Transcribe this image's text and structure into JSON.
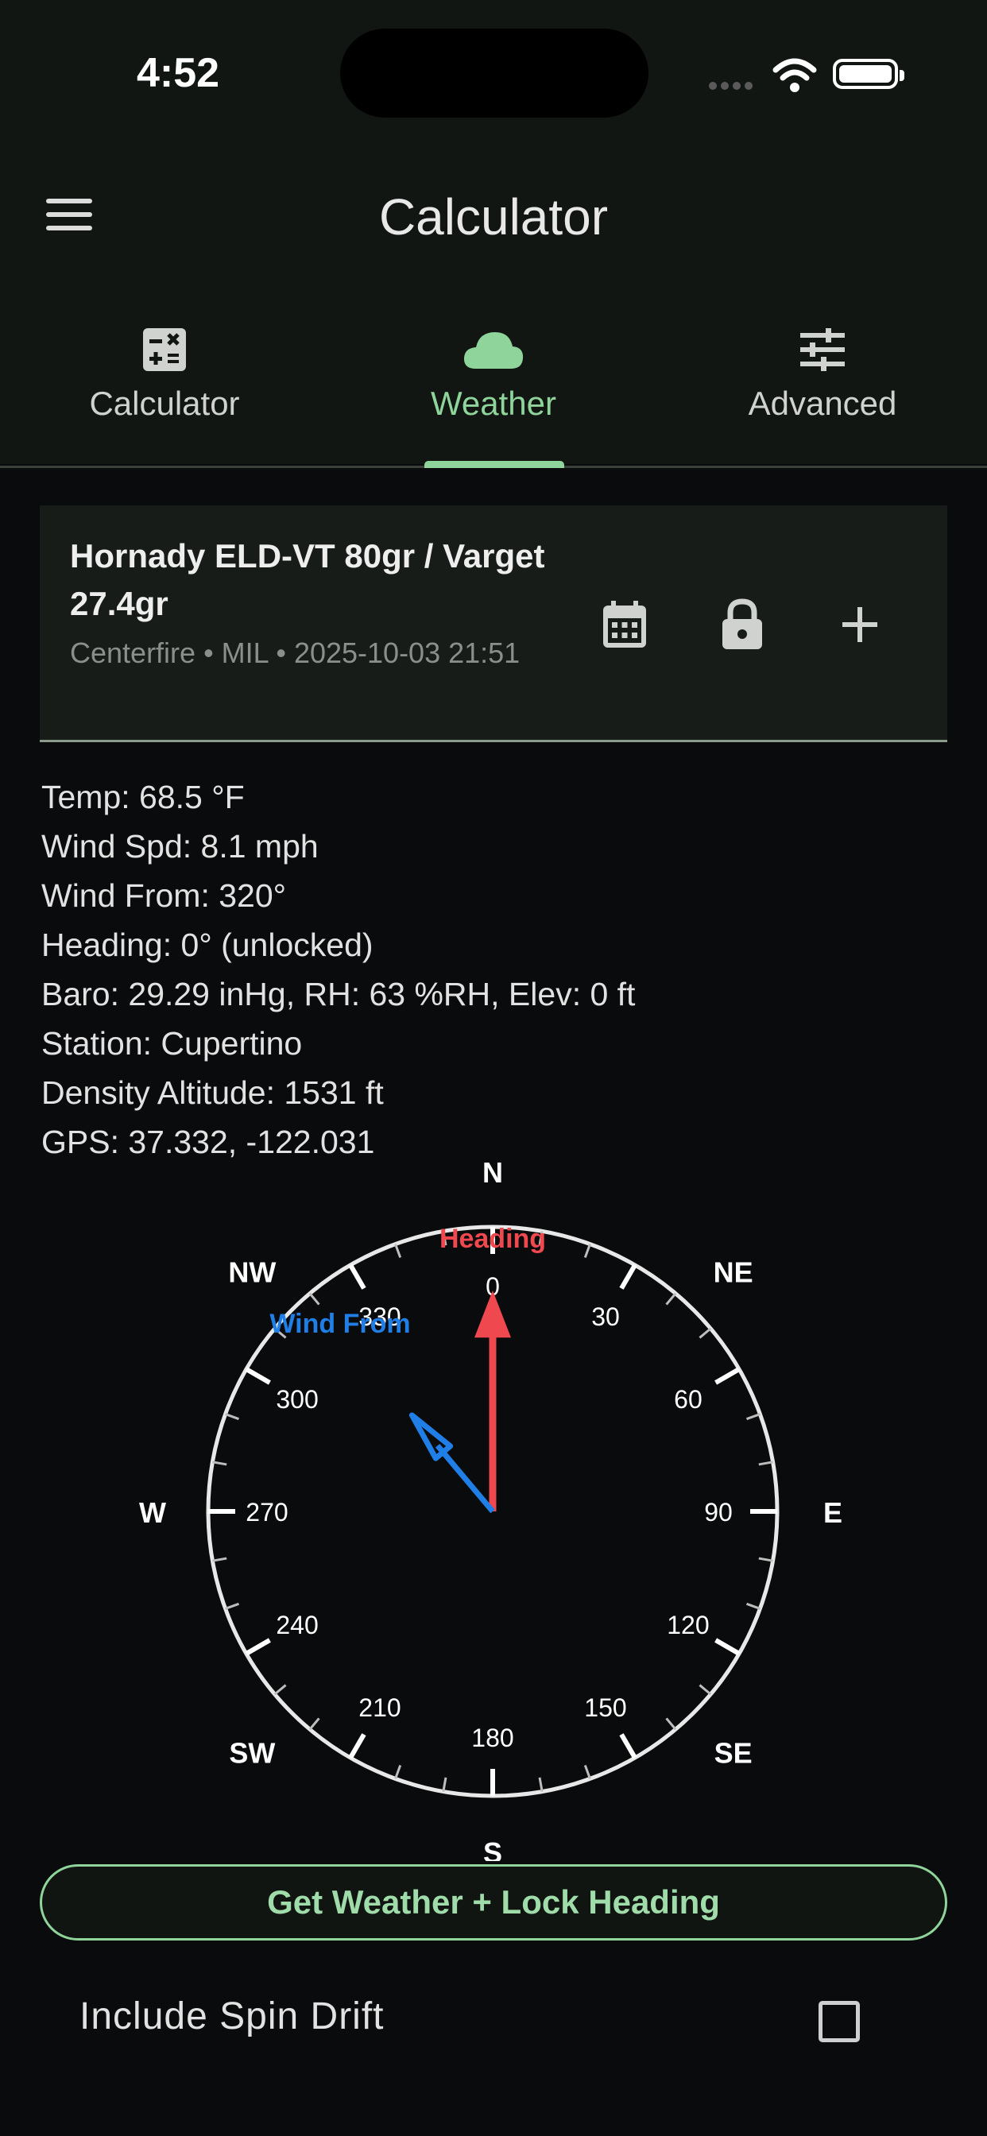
{
  "status_bar": {
    "time": "4:52"
  },
  "app_bar": {
    "title": "Calculator"
  },
  "tabs": [
    {
      "label": "Calculator",
      "icon": "calculator-icon",
      "active": false
    },
    {
      "label": "Weather",
      "icon": "cloud-icon",
      "active": true
    },
    {
      "label": "Advanced",
      "icon": "sliders-icon",
      "active": false
    }
  ],
  "profile": {
    "name": "Hornady ELD-VT 80gr / Varget 27.4gr",
    "meta": "Centerfire • MIL • 2025-10-03 21:51",
    "icons": [
      "calendar-icon",
      "lock-icon",
      "plus-icon"
    ]
  },
  "weather": {
    "temp": "Temp: 68.5 °F",
    "wind_speed": "Wind Spd: 8.1 mph",
    "wind_from": "Wind From: 320°",
    "heading": "Heading: 0° (unlocked)",
    "baro": "Baro: 29.29 inHg, RH: 63 %RH, Elev: 0 ft",
    "station": "Station: Cupertino",
    "density_altitude": "Density Altitude: 1531 ft",
    "gps": "GPS: 37.332, -122.031"
  },
  "compass": {
    "cardinals": [
      "N",
      "NE",
      "E",
      "SE",
      "S",
      "SW",
      "W",
      "NW"
    ],
    "degree_labels": [
      "0",
      "30",
      "60",
      "90",
      "120",
      "150",
      "180",
      "210",
      "240",
      "270",
      "300",
      "330"
    ],
    "heading_label": "Heading",
    "wind_label": "Wind From",
    "heading_deg": 0,
    "wind_from_deg": 320,
    "heading_color": "#f0484f",
    "wind_color": "#1f7fe6"
  },
  "action_button": "Get Weather + Lock Heading",
  "spin_drift": {
    "label": "Include Spin Drift",
    "checked": false
  },
  "colors": {
    "accent": "#8fd49b",
    "background": "#0a0b0c",
    "header": "#121613"
  }
}
